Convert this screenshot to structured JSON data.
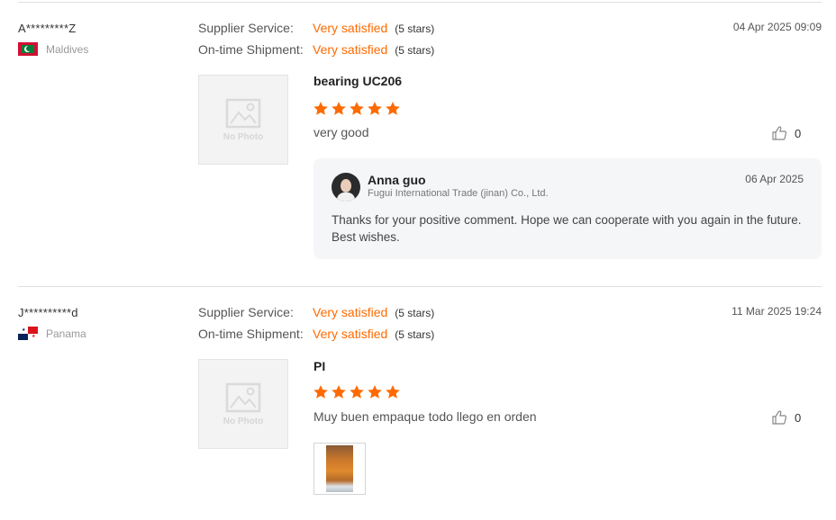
{
  "reviews": [
    {
      "buyer": "A*********Z",
      "country": "Maldives",
      "timestamp": "04 Apr 2025 09:09",
      "supplier_service_label": "Supplier Service:",
      "supplier_service_value": "Very satisfied",
      "supplier_service_stars": "(5 stars)",
      "shipment_label": "On-time Shipment:",
      "shipment_value": "Very satisfied",
      "shipment_stars": "(5 stars)",
      "photo_placeholder": "No Photo",
      "product": "bearing UC206",
      "rating": 5,
      "comment": "very good",
      "likes": "0",
      "reply": {
        "name": "Anna guo",
        "company": "Fugui International Trade (jinan) Co., Ltd.",
        "date": "06 Apr 2025",
        "text": "Thanks for your positive comment. Hope we can cooperate with you again in the future. Best wishes."
      }
    },
    {
      "buyer": "J**********d",
      "country": "Panama",
      "timestamp": "11 Mar 2025 19:24",
      "supplier_service_label": "Supplier Service:",
      "supplier_service_value": "Very satisfied",
      "supplier_service_stars": "(5 stars)",
      "shipment_label": "On-time Shipment:",
      "shipment_value": "Very satisfied",
      "shipment_stars": "(5 stars)",
      "photo_placeholder": "No Photo",
      "product": "PI",
      "rating": 5,
      "comment": "Muy buen empaque todo llego en orden",
      "likes": "0"
    }
  ],
  "colors": {
    "accent": "#ff6a00",
    "star": "#ff6a00",
    "reply_bg": "#f5f6f8"
  },
  "icons": {
    "like": "thumbs-up-icon",
    "star": "star-icon",
    "no_photo": "image-placeholder-icon"
  }
}
